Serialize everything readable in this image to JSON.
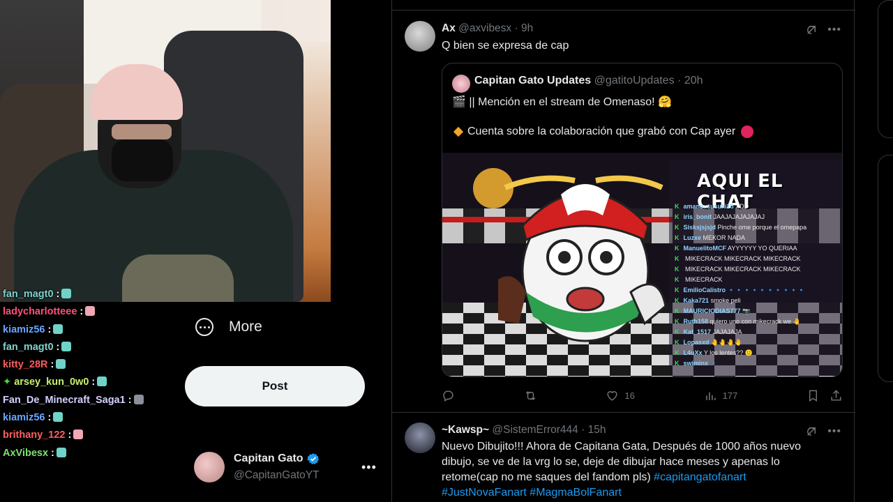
{
  "chat": [
    {
      "user": "fan_magt0",
      "color": "#7fd3d0",
      "emote": "#6fd3c8",
      "badge": false
    },
    {
      "user": "ladycharlotteee",
      "color": "#ff4f7d",
      "emote": "#f0a7b5",
      "badge": false
    },
    {
      "user": "kiamiz56",
      "color": "#6aa6ff",
      "emote": "#6fd3c8",
      "badge": false
    },
    {
      "user": "fan_magt0",
      "color": "#7fd3d0",
      "emote": "#6fd3c8",
      "badge": false
    },
    {
      "user": "kitty_28R",
      "color": "#ff5a5a",
      "emote": "#6fd3c8",
      "badge": false
    },
    {
      "user": "arsey_kun_0w0",
      "color": "#c7f06b",
      "emote": "#6fd3c8",
      "badge": true
    },
    {
      "user": "Fan_De_Minecraft_Saga1",
      "color": "#d4d0ff",
      "emote": "#8b8f99",
      "badge": false
    },
    {
      "user": "kiamiz56",
      "color": "#6aa6ff",
      "emote": "#6fd3c8",
      "badge": false
    },
    {
      "user": "brithany_122",
      "color": "#ff5f5f",
      "emote": "#f0a7b5",
      "badge": false
    },
    {
      "user": "AxVibesx",
      "color": "#7be36b",
      "emote": "#6fd3c8",
      "badge": false
    }
  ],
  "nav": {
    "more_label": "More",
    "post_label": "Post",
    "profile_name": "Capitan Gato",
    "profile_handle": "@CapitanGatoYT"
  },
  "tweet1": {
    "name": "Ax",
    "handle": "@axvibesx",
    "time": "9h",
    "text": "Q bien se expresa de cap",
    "quote": {
      "name": "Capitan Gato Updates",
      "handle": "@gatitoUpdates",
      "time": "20h",
      "line1": "🎬 || Mención en el stream de Omenaso! 🤗",
      "line2": "Cuenta sobre la colaboración que grabó con Cap ayer",
      "media": {
        "title": "AQUI EL CHAT",
        "lines": [
          {
            "u": "amane_susuki15",
            "m": "XDD"
          },
          {
            "u": "iris_bonit",
            "m": "JAAJAJAJAJAJAJ"
          },
          {
            "u": "Sisksjsjsjd",
            "m": "Pinche ome porque el omepapa"
          },
          {
            "u": "Luzxe",
            "m": "MEKOR NADA"
          },
          {
            "u": "ManuelitoMCF",
            "m": "AYYYYYY YO QUERIAA"
          },
          {
            "u": "",
            "m": "MIKECRACK MIKECRACK MIKECRACK"
          },
          {
            "u": "",
            "m": "MIKECRACK MIKECRACK MIKECRACK"
          },
          {
            "u": "",
            "m": "MIKECRACK"
          },
          {
            "u": "EmilioCalistro",
            "m": "🔹🔹🔹🔹🔹🔹🔹🔹🔹🔹"
          },
          {
            "u": "Kaka721",
            "m": "smoke peli"
          },
          {
            "u": "MAURICIODIAS777",
            "m": "📷"
          },
          {
            "u": "Ruth158",
            "m": "quiero uno con mikecrack we 🤚"
          },
          {
            "u": "Kat_1517",
            "m": "JAJAJAJA"
          },
          {
            "u": "Lopasxd",
            "m": "🤚🤚🤚🤚"
          },
          {
            "u": "L4uXx",
            "m": "Y los lentes?? 🙂"
          },
          {
            "u": "swiminx",
            "m": "🔹"
          }
        ]
      }
    },
    "likes": "16",
    "views": "177"
  },
  "tweet2": {
    "name": "~Kawsp~",
    "handle": "@SistemError444",
    "time": "15h",
    "text1": "Nuevo Dibujito!!! Ahora de Capitana Gata, Después de 1000 años nuevo",
    "text2": "dibujo, se ve de la vrg lo se, deje de dibujar hace meses y apenas lo",
    "text3": "retome(cap no me saques del fandom pls)",
    "hashtag1": "#capitangatofanart",
    "hashtag2": "#JustNovaFanart",
    "hashtag3": "#MagmaBolFanart"
  },
  "colors": {
    "background": "#000000",
    "border": "#2f3336",
    "muted": "#71767b",
    "link": "#1d9bf0",
    "verified": "#1d9bf0"
  }
}
